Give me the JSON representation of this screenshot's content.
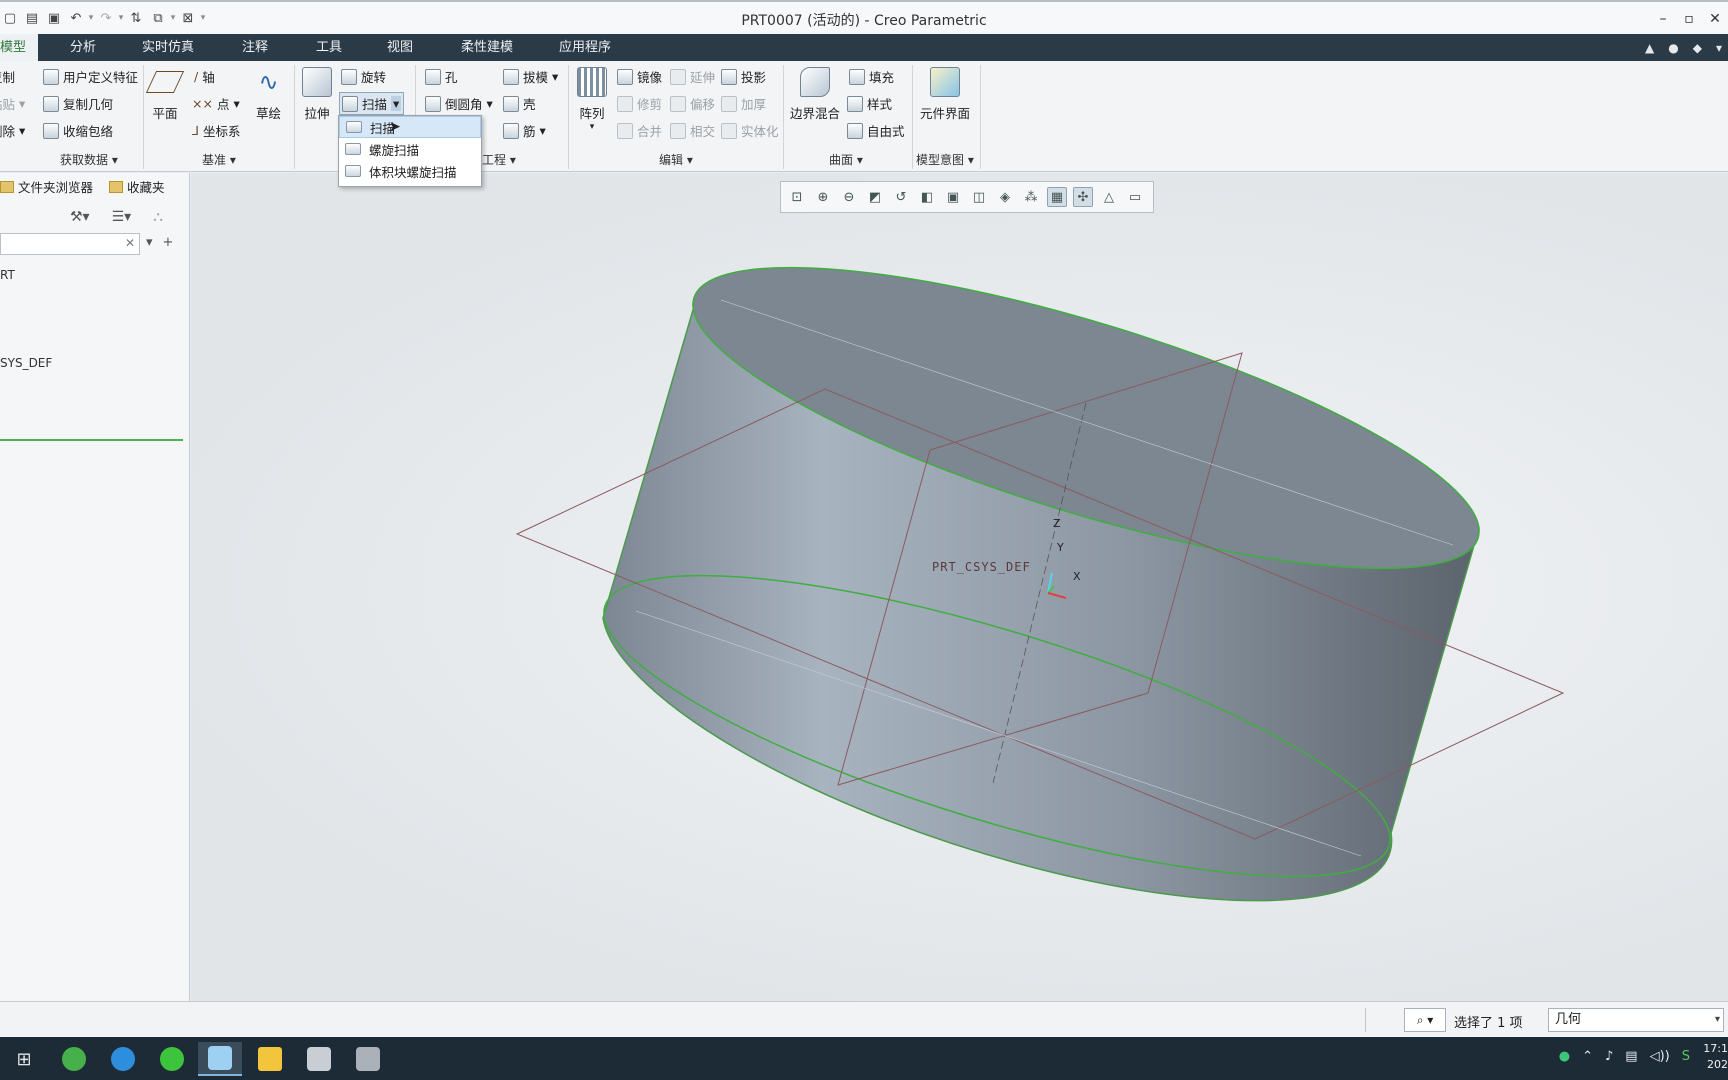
{
  "window": {
    "title": "PRT0007 (活动的) - Creo Parametric"
  },
  "tabs": [
    "模型",
    "分析",
    "实时仿真",
    "注释",
    "工具",
    "视图",
    "柔性建模",
    "应用程序"
  ],
  "ribbon": {
    "get_data": {
      "items": [
        "复制",
        "粘贴",
        "删除",
        "用户定义特征",
        "复制几何",
        "收缩包络"
      ],
      "label": "获取数据"
    },
    "datum": {
      "plane": "平面",
      "axis": "轴",
      "point": "点",
      "csys": "坐标系",
      "sketch": "草绘",
      "label": "基准"
    },
    "shapes": {
      "extrude": "拉伸",
      "revolve": "旋转",
      "sweep": "扫描"
    },
    "engineering": {
      "hole": "孔",
      "round": "倒圆角",
      "draft": "拔模",
      "shell": "壳",
      "rib": "筋",
      "label": "工程"
    },
    "editing": {
      "pattern": "阵列",
      "mirror": "镜像",
      "extend": "延伸",
      "project": "投影",
      "trim": "修剪",
      "offset": "偏移",
      "thicken": "加厚",
      "merge": "合并",
      "intersect": "相交",
      "solidify": "实体化",
      "label": "编辑"
    },
    "surfaces": {
      "boundary_blend": "边界混合",
      "fill": "填充",
      "style": "样式",
      "freestyle": "自由式",
      "label": "曲面"
    },
    "model_intent": {
      "component_interface": "元件界面",
      "label": "模型意图"
    }
  },
  "sweep_menu": [
    "扫描",
    "螺旋扫描",
    "体积块螺旋扫描"
  ],
  "left_panel": {
    "tabs": [
      "文件夹浏览器",
      "收藏夹"
    ],
    "tree": [
      "RT",
      "SYS_DEF"
    ]
  },
  "viewport": {
    "csys_label": "PRT_CSYS_DEF",
    "axes": {
      "x": "X",
      "y": "Y",
      "z": "Z"
    }
  },
  "status": {
    "selection": "选择了 1 项",
    "filter": "几何"
  },
  "taskbar": {
    "time": "17:1",
    "date": "202"
  },
  "colors": {
    "tab_bar": "#2b3a47",
    "active_tab_text": "#2f7a3d",
    "edge_highlight": "#3fae3f",
    "datum_plane": "#8a5a5e"
  }
}
